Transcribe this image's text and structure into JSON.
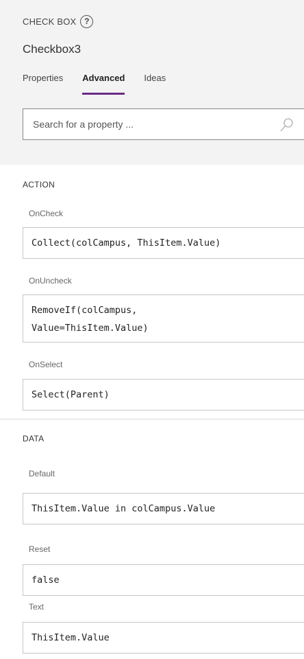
{
  "header": {
    "control_type": "CHECK BOX",
    "help_icon": "help-circle-icon",
    "control_name": "Checkbox3"
  },
  "tabs": [
    {
      "label": "Properties",
      "active": false
    },
    {
      "label": "Advanced",
      "active": true
    },
    {
      "label": "Ideas",
      "active": false
    }
  ],
  "search": {
    "placeholder": "Search for a property ...",
    "icon": "search-icon"
  },
  "sections": {
    "action": {
      "title": "ACTION",
      "properties": [
        {
          "label": "OnCheck",
          "value": "Collect(colCampus, ThisItem.Value)"
        },
        {
          "label": "OnUncheck",
          "value": "RemoveIf(colCampus,\nValue=ThisItem.Value)"
        },
        {
          "label": "OnSelect",
          "value": "Select(Parent)"
        }
      ]
    },
    "data": {
      "title": "DATA",
      "properties": [
        {
          "label": "Default",
          "value": "ThisItem.Value in colCampus.Value"
        },
        {
          "label": "Reset",
          "value": "false"
        },
        {
          "label": "Text",
          "value": "ThisItem.Value"
        }
      ]
    }
  },
  "colors": {
    "accent": "#6a2b85",
    "header_background": "#f3f3f3"
  }
}
